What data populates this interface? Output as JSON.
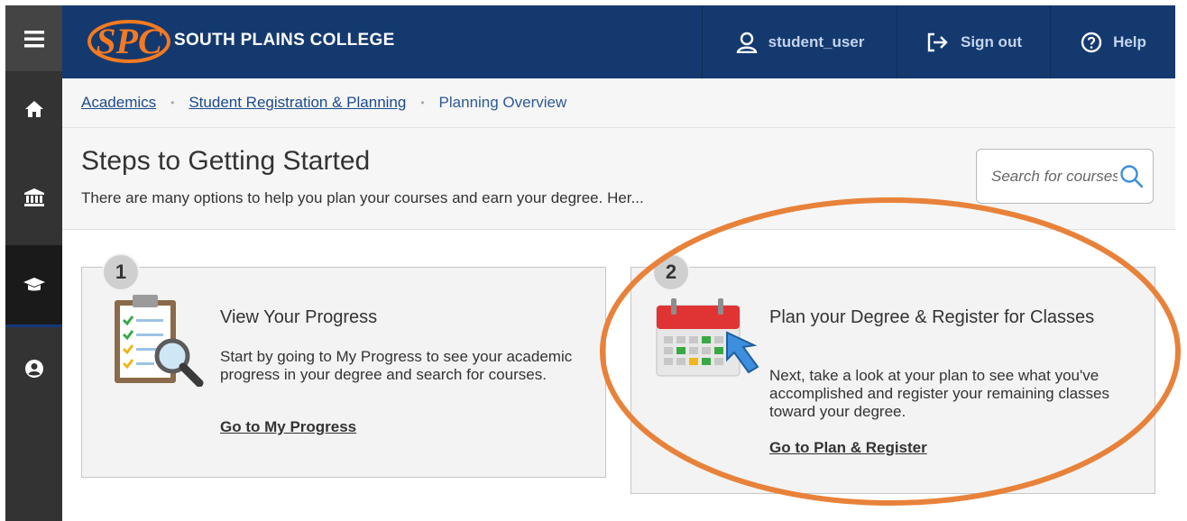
{
  "header": {
    "college_name": "SOUTH PLAINS COLLEGE",
    "logo_letters": "SPC",
    "user_label": "student_user",
    "signout_label": "Sign out",
    "help_label": "Help"
  },
  "sidebar": {
    "items": [
      {
        "icon": "hamburger-menu-icon"
      },
      {
        "icon": "home-icon"
      },
      {
        "icon": "bank-building-icon"
      },
      {
        "icon": "graduation-cap-icon",
        "active": true
      },
      {
        "icon": "user-circle-icon"
      }
    ]
  },
  "breadcrumb": {
    "items": [
      "Academics",
      "Student Registration & Planning",
      "Planning Overview"
    ]
  },
  "page": {
    "title": "Steps to Getting Started",
    "subtitle": "There are many options to help you plan your courses and earn your degree. Her..."
  },
  "search": {
    "placeholder": "Search for courses"
  },
  "cards": [
    {
      "number": "1",
      "title": "View Your Progress",
      "description": "Start by going to My Progress to see your academic progress in your degree and search for courses.",
      "link": "Go to My Progress",
      "icon": "clipboard-magnifier-icon"
    },
    {
      "number": "2",
      "title": "Plan your Degree & Register for Classes",
      "description": "Next, take a look at your plan to see what you've accomplished and register your remaining classes toward your degree.",
      "link": "Go to Plan & Register",
      "icon": "calendar-cursor-icon"
    }
  ],
  "colors": {
    "header_bg": "#14396f",
    "rail_bg": "#333333",
    "logo_orange": "#f37a21",
    "highlight_ring": "#e8823a"
  }
}
